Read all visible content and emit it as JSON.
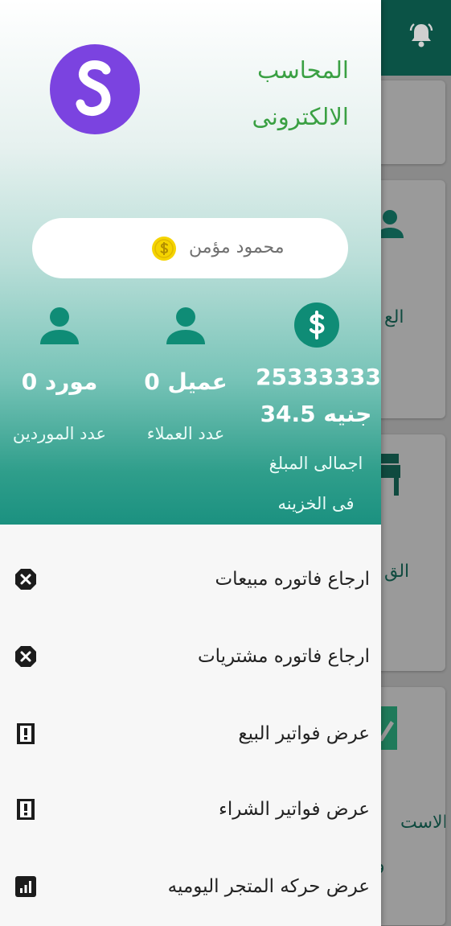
{
  "app": {
    "title_line1": "المحاسب",
    "title_line2": "الالكترونى",
    "logo_letter": "S",
    "brand_color": "#7b43e0",
    "accent_color": "#0b5346"
  },
  "user": {
    "name": "محمود مؤمن",
    "icon": "coin-dollar-icon"
  },
  "stats": {
    "treasury_amount_line1": "25333333",
    "treasury_amount_line2": "جنيه 34.5",
    "treasury_label_line1": "اجمالى المبلغ",
    "treasury_label_line2": "فى الخزينه",
    "customers_value": "عميل 0",
    "customers_label": "عدد العملاء",
    "suppliers_value": "مورد 0",
    "suppliers_label": "عدد الموردين"
  },
  "menu": [
    {
      "label": "ارجاع فاتوره مبيعات",
      "icon": "cancel-circle-icon"
    },
    {
      "label": "ارجاع فاتوره مشتريات",
      "icon": "cancel-circle-icon"
    },
    {
      "label": "عرض فواتير البيع",
      "icon": "receipt-alert-icon"
    },
    {
      "label": "عرض فواتير الشراء",
      "icon": "receipt-alert-icon"
    },
    {
      "label": "عرض حركه المتجر اليوميه",
      "icon": "bar-chart-icon"
    }
  ],
  "background": {
    "card_fragment_1": "الع",
    "card_fragment_2": "الق",
    "card_fragment_3a": "الاست",
    "card_fragment_3b": "و"
  }
}
